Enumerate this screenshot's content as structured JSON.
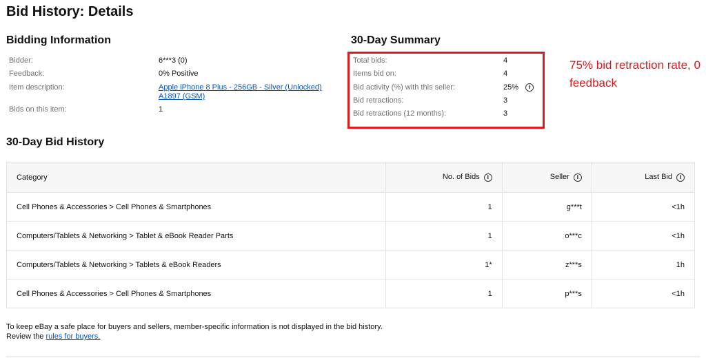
{
  "page_title": "Bid History: Details",
  "bidding_info": {
    "heading": "Bidding Information",
    "rows": [
      {
        "label": "Bidder:",
        "value": "6***3 (0)"
      },
      {
        "label": "Feedback:",
        "value": "0% Positive"
      },
      {
        "label": "Item description:",
        "value": "Apple iPhone 8 Plus - 256GB - Silver (Unlocked)",
        "value2": "A1897 (GSM)"
      },
      {
        "label": "Bids on this item:",
        "value": "1"
      }
    ]
  },
  "summary": {
    "heading": "30-Day Summary",
    "rows": [
      {
        "label": "Total bids:",
        "value": "4"
      },
      {
        "label": "Items bid on:",
        "value": "4"
      },
      {
        "label": "Bid activity (%) with this seller:",
        "value": "25%"
      },
      {
        "label": "Bid retractions:",
        "value": "3"
      },
      {
        "label": "Bid retractions (12 months):",
        "value": "3"
      }
    ]
  },
  "annotation": {
    "text": "75% bid retraction rate, 0 feedback",
    "color": "#e0191d"
  },
  "history": {
    "heading": "30-Day Bid History",
    "columns": {
      "category": "Category",
      "bids": "No. of Bids",
      "seller": "Seller",
      "last_bid": "Last Bid"
    },
    "rows": [
      {
        "category": "Cell Phones & Accessories > Cell Phones & Smartphones",
        "bids": "1",
        "seller": "g***t",
        "last_bid": "<1h"
      },
      {
        "category": "Computers/Tablets & Networking > Tablet & eBook Reader Parts",
        "bids": "1",
        "seller": "o***c",
        "last_bid": "<1h"
      },
      {
        "category": "Computers/Tablets & Networking > Tablets & eBook Readers",
        "bids": "1*",
        "seller": "z***s",
        "last_bid": "1h"
      },
      {
        "category": "Cell Phones & Accessories > Cell Phones & Smartphones",
        "bids": "1",
        "seller": "p***s",
        "last_bid": "<1h"
      }
    ]
  },
  "footer": {
    "text": "To keep eBay a safe place for buyers and sellers, member-specific information is not displayed in the bid history. Review the",
    "link": "rules for buyers."
  },
  "icons": {
    "info": "info-circle-icon"
  },
  "colors": {
    "link": "#0654ba",
    "highlight": "#e0191d"
  }
}
